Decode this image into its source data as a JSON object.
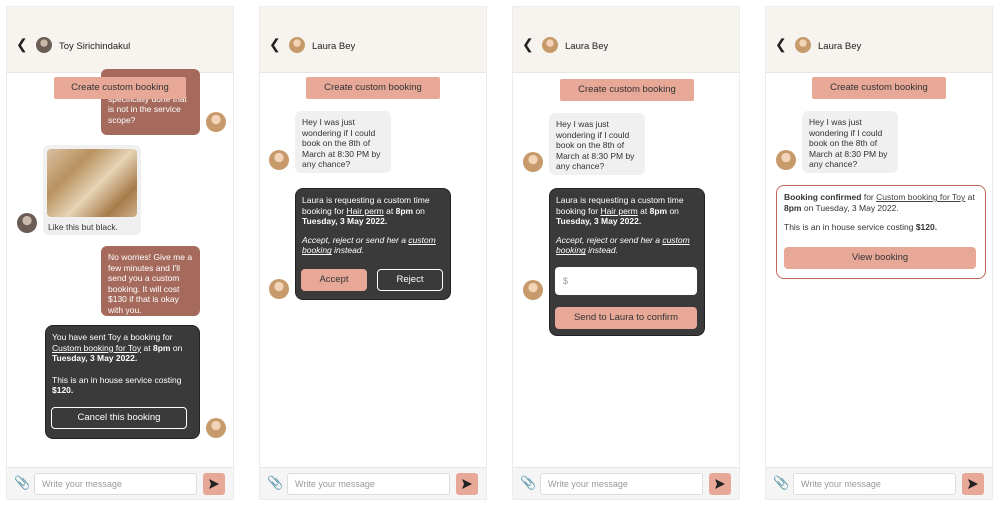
{
  "common": {
    "create_custom_booking": "Create custom booking",
    "message_placeholder": "Write your message",
    "accent_color": "#e8a898",
    "brown_bubble_color": "#a56a5c",
    "dark_card_color": "#3a3a3a"
  },
  "screen1": {
    "contact_name": "Toy Sirichindakul",
    "msg_top_partial": "want anything specifically done that is not in the service scope?",
    "photo_caption": "Like this but black.",
    "msg_reply": "No worries! Give me a few minutes and I'll send you a custom booking. It will cost $130 if that is okay with you.",
    "sent_card": {
      "line1": "You have sent Toy a booking for",
      "booking_link": "Custom booking for Toy",
      "at": "at",
      "time": "8pm",
      "on": "on",
      "date": "Tuesday, 3 May 2022.",
      "service_text": "This is an in house service costing",
      "price": "$120.",
      "cancel_button": "Cancel this booking"
    }
  },
  "screen2": {
    "contact_name": "Laura Bey",
    "msg_question": "Hey I was just wondering if I could book on the 8th of March at 8:30 PM by any chance?",
    "request_card": {
      "line1": "Laura is requesting a custom time booking for",
      "service_link": "Hair perm",
      "at": "at",
      "time": "8pm",
      "on": "on",
      "date": "Tuesday, 3 May 2022.",
      "instructions": "Accept, reject or send her a",
      "custom_link": "custom booking",
      "instead": "instead.",
      "accept_button": "Accept",
      "reject_button": "Reject"
    }
  },
  "screen3": {
    "contact_name": "Laura Bey",
    "msg_question": "Hey I was just wondering if I could book on the 8th of March at 8:30 PM by any chance?",
    "request_card": {
      "line1": "Laura is requesting a custom time booking for",
      "service_link": "Hair perm",
      "at": "at",
      "time": "8pm",
      "on": "on",
      "date": "Tuesday, 3 May 2022.",
      "instructions": "Accept, reject or send her a",
      "custom_link": "custom booking",
      "instead": "instead.",
      "price_placeholder": "$",
      "send_button": "Send to Laura to confirm"
    }
  },
  "screen4": {
    "contact_name": "Laura Bey",
    "msg_question": "Hey I was just wondering if I could book on the 8th of March at 8:30 PM by any chance?",
    "confirm_card": {
      "title": "Booking confirmed",
      "for": "for",
      "booking_link": "Custom booking for Toy",
      "at": "at",
      "time": "8pm",
      "on": "on",
      "date": "Tuesday, 3 May 2022.",
      "service_text": "This is an in house service costing",
      "price": "$120.",
      "view_button": "View booking"
    }
  }
}
